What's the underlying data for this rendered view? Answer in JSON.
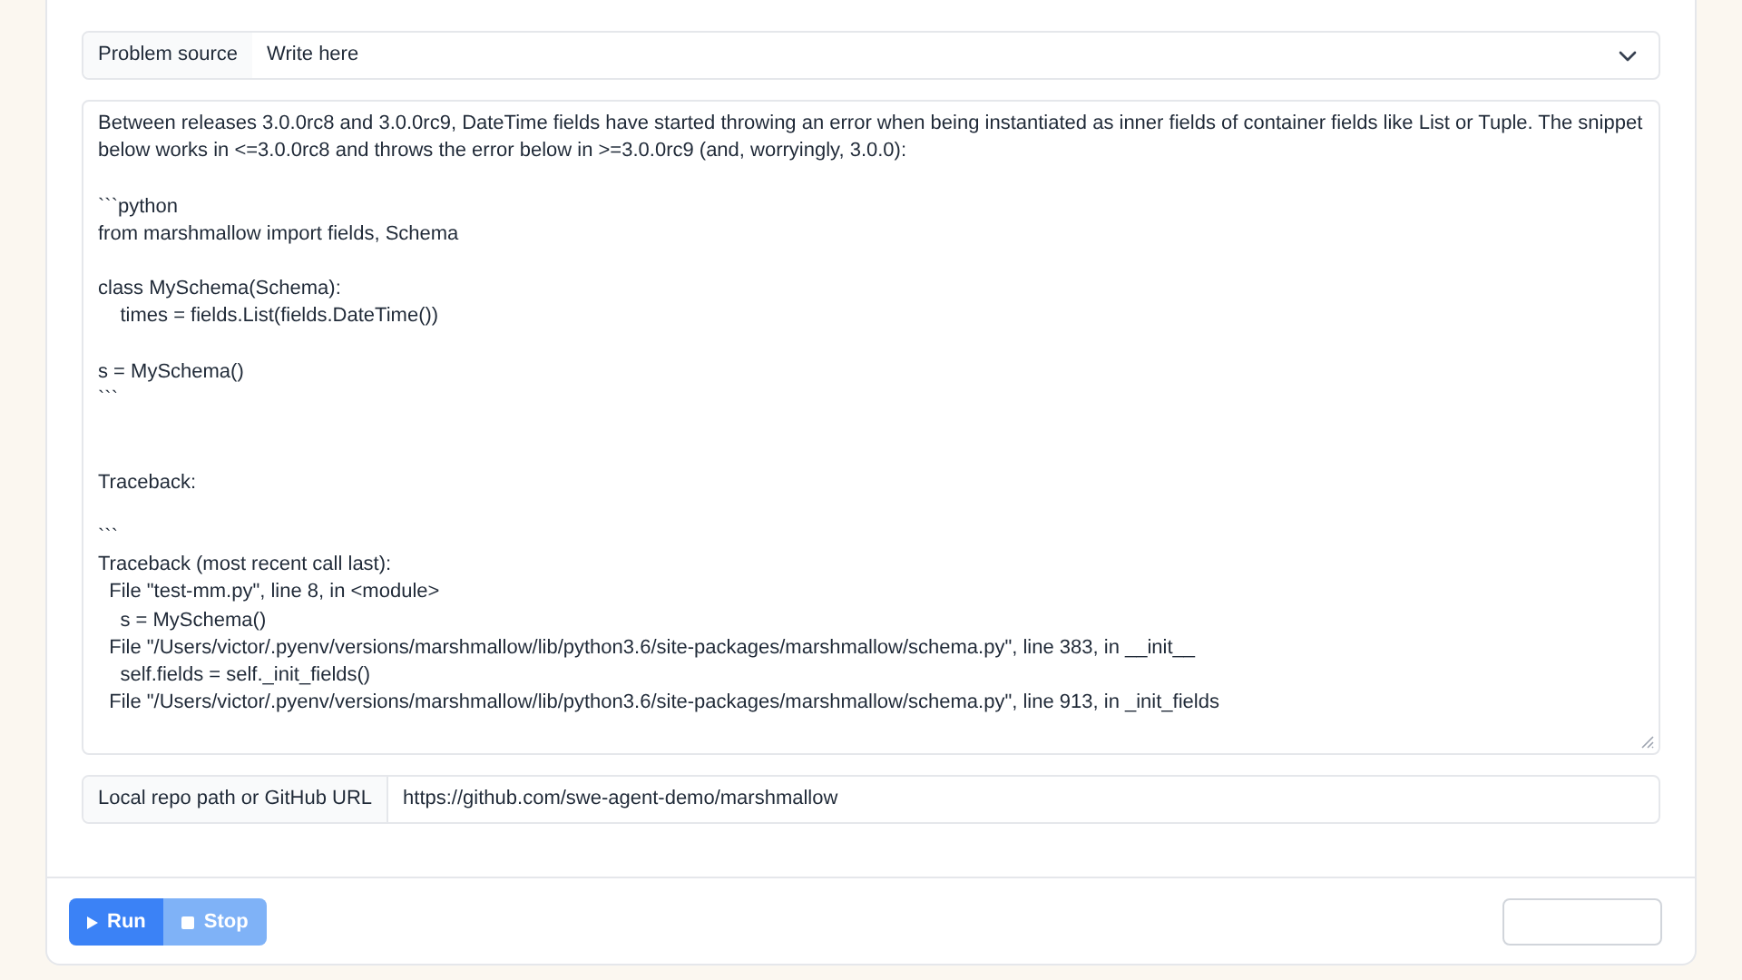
{
  "problem_source": {
    "label": "Problem source",
    "value": "Write here"
  },
  "description": {
    "value": "Between releases 3.0.0rc8 and 3.0.0rc9, DateTime fields have started throwing an error when being instantiated as inner fields of container fields like List or Tuple. The snippet below works in <=3.0.0rc8 and throws the error below in >=3.0.0rc9 (and, worryingly, 3.0.0):\n\n```python\nfrom marshmallow import fields, Schema\n\nclass MySchema(Schema):\n    times = fields.List(fields.DateTime())\n\ns = MySchema()\n```\n\n\nTraceback:\n\n```\nTraceback (most recent call last):\n  File \"test-mm.py\", line 8, in <module>\n    s = MySchema()\n  File \"/Users/victor/.pyenv/versions/marshmallow/lib/python3.6/site-packages/marshmallow/schema.py\", line 383, in __init__\n    self.fields = self._init_fields()\n  File \"/Users/victor/.pyenv/versions/marshmallow/lib/python3.6/site-packages/marshmallow/schema.py\", line 913, in _init_fields"
  },
  "repo": {
    "label": "Local repo path or GitHub URL",
    "value": "https://github.com/swe-agent-demo/marshmallow"
  },
  "actions": [
    {
      "kind": "run",
      "label": "Run",
      "disabled": false
    },
    {
      "kind": "stop",
      "label": "Stop",
      "disabled": true
    }
  ]
}
